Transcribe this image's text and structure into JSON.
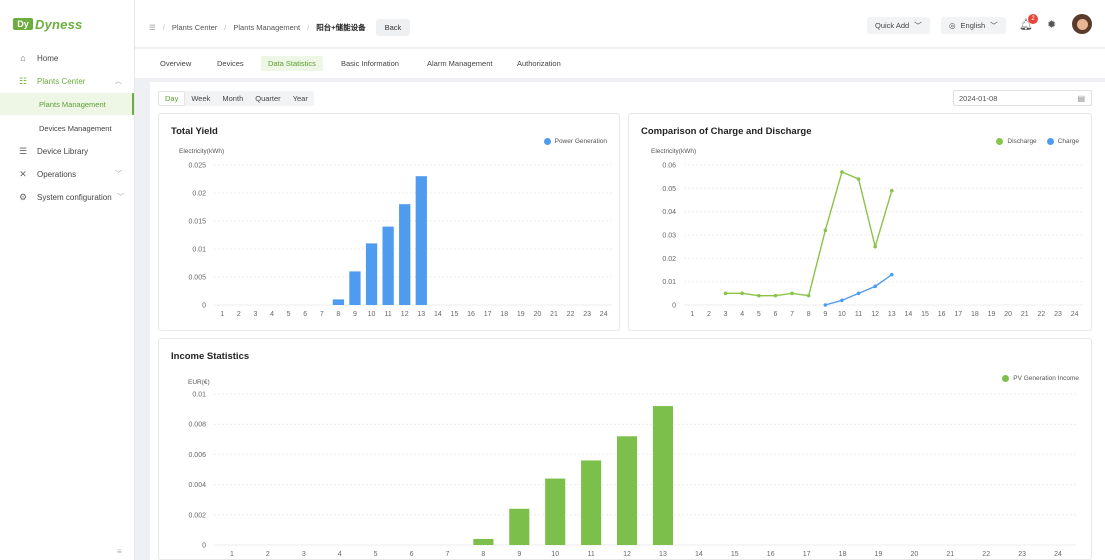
{
  "brand": {
    "logo_mark": "Dy",
    "logo_text": "Dyness",
    "accent": "#6cae3e"
  },
  "sidebar": {
    "items": [
      {
        "label": "Home",
        "icon": "home-icon"
      },
      {
        "label": "Plants Center",
        "icon": "plants-icon",
        "expanded": true
      },
      {
        "label": "Device Library",
        "icon": "database-icon"
      },
      {
        "label": "Operations",
        "icon": "tools-icon"
      },
      {
        "label": "System configuration",
        "icon": "settings-icon"
      }
    ],
    "sub_items": [
      {
        "label": "Plants Management",
        "active": true
      },
      {
        "label": "Devices Management",
        "active": false
      }
    ]
  },
  "header": {
    "breadcrumb": [
      "Plants Center",
      "Plants Management",
      "阳台+储能设备"
    ],
    "back_label": "Back",
    "quick_add": "Quick Add",
    "language": "English",
    "notification_count": "2"
  },
  "tabs": [
    "Overview",
    "Devices",
    "Data Statistics",
    "Basic Information",
    "Alarm Management",
    "Authorization"
  ],
  "active_tab": "Data Statistics",
  "periods": [
    "Day",
    "Week",
    "Month",
    "Quarter",
    "Year"
  ],
  "active_period": "Day",
  "date_value": "2024-01-08",
  "chart_data": [
    {
      "type": "bar",
      "title": "Total Yield",
      "ylabel": "Electricity(kWh)",
      "ylim": [
        0,
        0.025
      ],
      "yticks": [
        "0",
        "0.005",
        "0.01",
        "0.015",
        "0.02",
        "0.025"
      ],
      "categories": [
        "1",
        "2",
        "3",
        "4",
        "5",
        "6",
        "7",
        "8",
        "9",
        "10",
        "11",
        "12",
        "13",
        "14",
        "15",
        "16",
        "17",
        "18",
        "19",
        "20",
        "21",
        "22",
        "23",
        "24"
      ],
      "series": [
        {
          "name": "Power Generation",
          "color": "#4f9bef",
          "values": [
            0,
            0,
            0,
            0,
            0,
            0,
            0,
            0.001,
            0.006,
            0.011,
            0.014,
            0.018,
            0.023,
            0,
            0,
            0,
            0,
            0,
            0,
            0,
            0,
            0,
            0,
            0
          ]
        }
      ],
      "legend": "top-right"
    },
    {
      "type": "line",
      "title": "Comparison of Charge and Discharge",
      "ylabel": "Electricity(kWh)",
      "ylim": [
        0,
        0.06
      ],
      "yticks": [
        "0",
        "0.01",
        "0.02",
        "0.03",
        "0.04",
        "0.05",
        "0.06"
      ],
      "categories": [
        "1",
        "2",
        "3",
        "4",
        "5",
        "6",
        "7",
        "8",
        "9",
        "10",
        "11",
        "12",
        "13",
        "14",
        "15",
        "16",
        "17",
        "18",
        "19",
        "20",
        "21",
        "22",
        "23",
        "24"
      ],
      "series": [
        {
          "name": "Discharge",
          "color": "#8bc34a",
          "values": [
            null,
            null,
            0.005,
            0.005,
            0.004,
            0.004,
            0.005,
            0.004,
            0.032,
            0.057,
            0.054,
            0.025,
            0.049,
            null,
            null,
            null,
            null,
            null,
            null,
            null,
            null,
            null,
            null,
            null
          ]
        },
        {
          "name": "Charge",
          "color": "#4f9bef",
          "values": [
            null,
            null,
            null,
            null,
            null,
            null,
            null,
            null,
            0,
            0.002,
            0.005,
            0.008,
            0.013,
            null,
            null,
            null,
            null,
            null,
            null,
            null,
            null,
            null,
            null,
            null
          ]
        }
      ],
      "legend": "top-right"
    },
    {
      "type": "bar",
      "title": "Income Statistics",
      "ylabel": "EUR(€)",
      "ylim": [
        0,
        0.01
      ],
      "yticks": [
        "0",
        "0.002",
        "0.004",
        "0.006",
        "0.008",
        "0.01"
      ],
      "categories": [
        "1",
        "2",
        "3",
        "4",
        "5",
        "6",
        "7",
        "8",
        "9",
        "10",
        "11",
        "12",
        "13",
        "14",
        "15",
        "16",
        "17",
        "18",
        "19",
        "20",
        "21",
        "22",
        "23",
        "24"
      ],
      "series": [
        {
          "name": "PV Generation Income",
          "color": "#7cc04b",
          "values": [
            0,
            0,
            0,
            0,
            0,
            0,
            0,
            0.0004,
            0.0024,
            0.0044,
            0.0056,
            0.0072,
            0.0092,
            0,
            0,
            0,
            0,
            0,
            0,
            0,
            0,
            0,
            0,
            0
          ]
        }
      ],
      "legend": "top-right"
    }
  ]
}
